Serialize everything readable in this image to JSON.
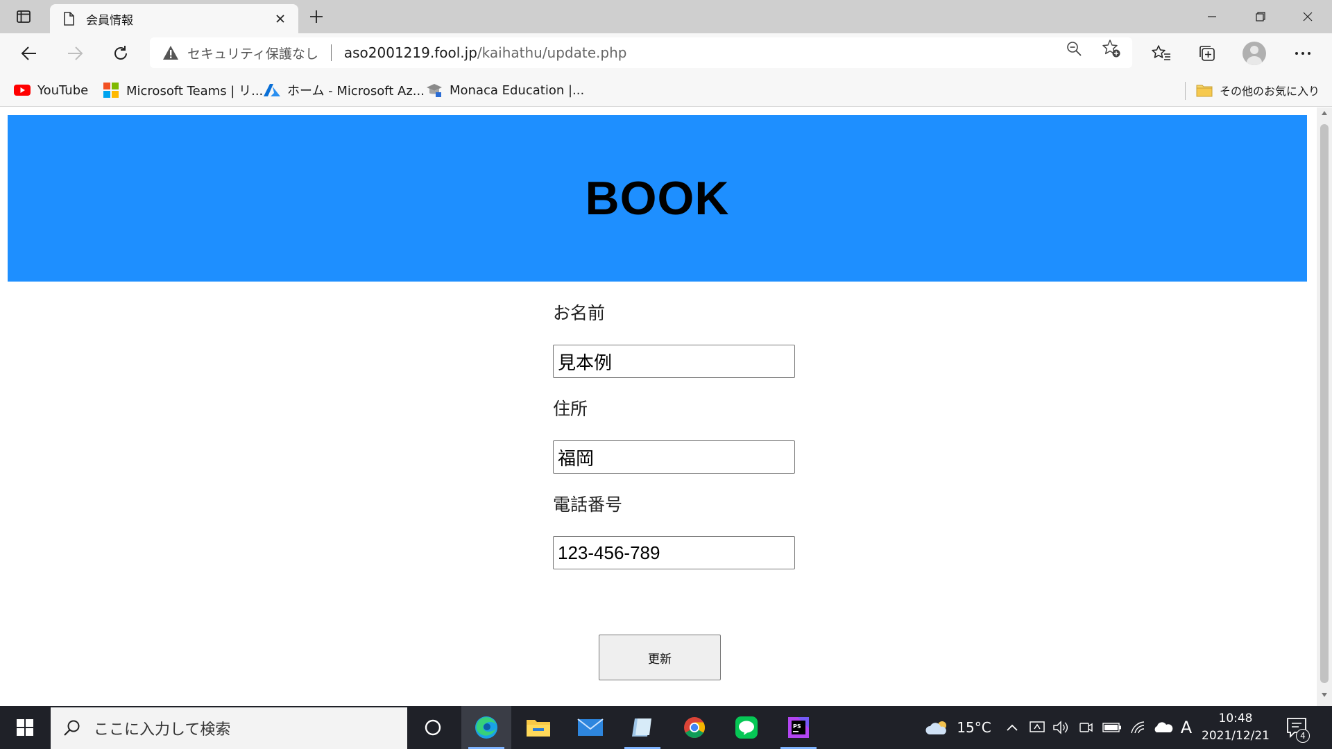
{
  "browser": {
    "tab": {
      "title": "会員情報"
    },
    "address": {
      "security_text": "セキュリティ保護なし",
      "url_host": "aso2001219.fool.jp",
      "url_path": "/kaihathu/update.php"
    },
    "favorites": [
      {
        "label": "YouTube",
        "icon": "youtube-icon"
      },
      {
        "label": "Microsoft Teams | リ...",
        "icon": "microsoft-icon"
      },
      {
        "label": "ホーム - Microsoft Az...",
        "icon": "azure-icon"
      },
      {
        "label": "Monaca Education |...",
        "icon": "monaca-icon"
      }
    ],
    "other_favorites": "その他のお気に入り"
  },
  "page": {
    "header_title": "BOOK",
    "form": {
      "name_label": "お名前",
      "name_value": "見本例",
      "address_label": "住所",
      "address_value": "福岡",
      "phone_label": "電話番号",
      "phone_value": "123-456-789",
      "submit_label": "更新"
    }
  },
  "taskbar": {
    "search_placeholder": "ここに入力して検索",
    "weather": "15°C",
    "ime": "A",
    "time": "10:48",
    "date": "2021/12/21",
    "notification_count": "4"
  }
}
